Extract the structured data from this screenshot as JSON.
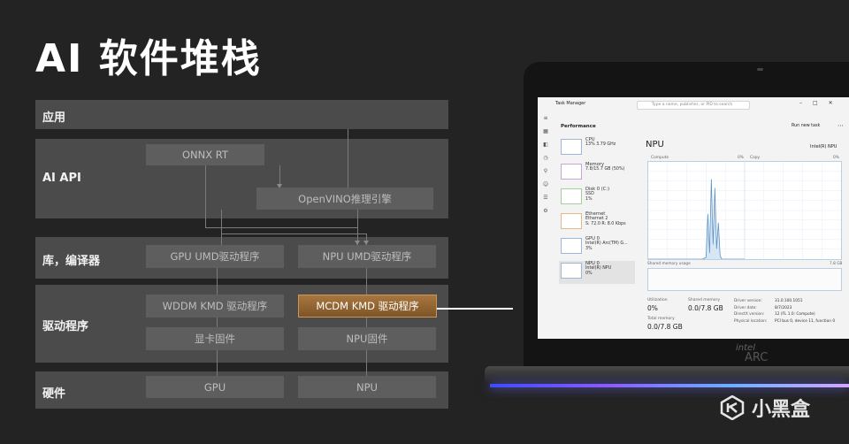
{
  "title": "AI 软件堆栈",
  "stack": {
    "rows": [
      {
        "label": "应用"
      },
      {
        "label": "AI API"
      },
      {
        "label": "库，编译器"
      },
      {
        "label": "驱动程序"
      },
      {
        "label": "硬件"
      }
    ],
    "boxes": {
      "onnx": "ONNX RT",
      "openvino": "OpenVINO推理引擎",
      "gpu_umd": "GPU UMD驱动程序",
      "npu_umd": "NPU UMD驱动程序",
      "wddm_kmd": "WDDM KMD 驱动程序",
      "mcdm_kmd": "MCDM KMD 驱动程序",
      "gpu_fw": "显卡固件",
      "npu_fw": "NPU固件",
      "gpu": "GPU",
      "npu": "NPU"
    },
    "highlight_color": "#9a6a34"
  },
  "laptop": {
    "brand_small": "intel",
    "brand_large": "ARC",
    "task_manager": {
      "app_title": "Task Manager",
      "search_placeholder": "Type a name, publisher, or PID to search",
      "section": "Performance",
      "run_new_task": "Run new task",
      "devices": [
        {
          "name": "CPU",
          "detail": "13% 3.79 GHz"
        },
        {
          "name": "Memory",
          "detail": "7.8/15.7 GB (50%)"
        },
        {
          "name": "Disk 0 (C:)",
          "detail": "SSD\n1%"
        },
        {
          "name": "Ethernet",
          "detail": "Ethernet 2\nS: 72.0 R: 8.0 Kbps"
        },
        {
          "name": "GPU 0",
          "detail": "Intel(R) Arc(TM) G...\n3%"
        },
        {
          "name": "NPU 0",
          "detail": "Intel(R) NPU\n0%"
        }
      ],
      "heading": "NPU",
      "device_name": "Intel(R) NPU",
      "graph_left": "Compute",
      "graph_left_pct": "0%",
      "graph_right": "Copy",
      "graph_right_pct": "0%",
      "shared_memory_label": "Shared memory usage",
      "shared_memory_max": "7.8 GB",
      "utilization_label": "Utilization",
      "utilization_value": "0%",
      "shared_memory_stat_label": "Shared memory",
      "shared_memory_stat_value": "0.0/7.8 GB",
      "total_memory_label": "Total memory",
      "total_memory_value": "0.0/7.8 GB",
      "info_labels": [
        "Driver version:",
        "Driver date:",
        "DirectX version:",
        "Physical location:"
      ],
      "info_values": [
        "31.0.100.1051",
        "8/7/2023",
        "12 (FL 1.0: Compute)",
        "PCI bus 0, device 11, function 0"
      ]
    }
  },
  "watermark": "小黑盒"
}
